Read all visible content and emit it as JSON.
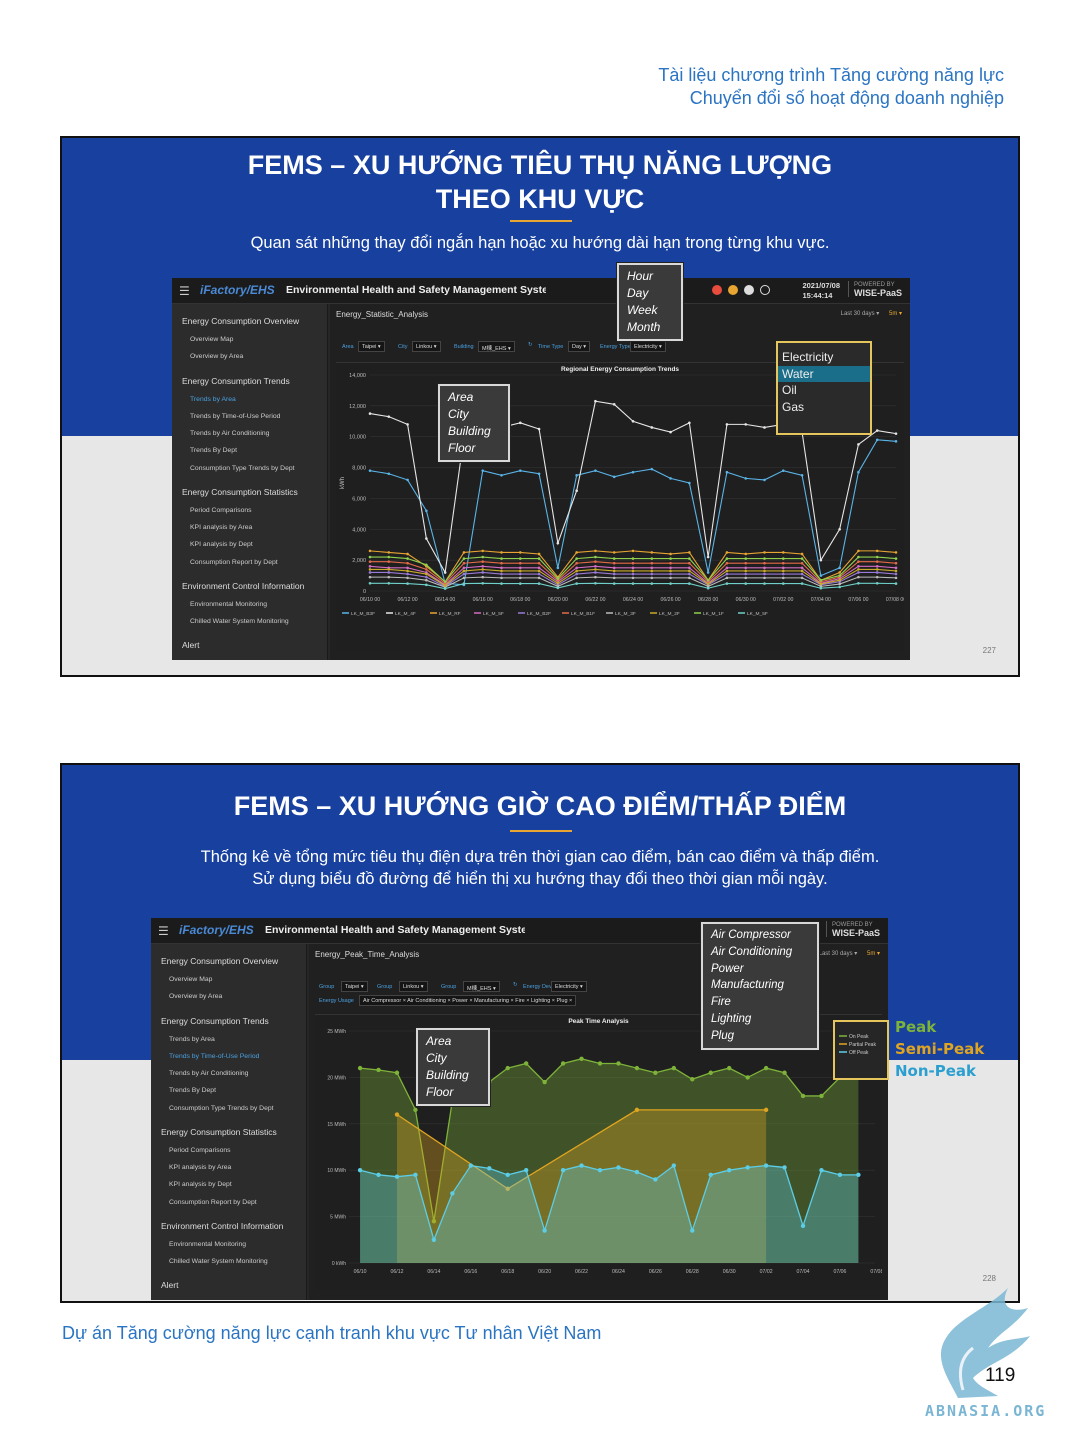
{
  "header": {
    "line1": "Tài liệu chương trình Tăng cường năng lực",
    "line2": "Chuyển đổi số hoạt động doanh nghiệp"
  },
  "slide1": {
    "title_line1": "FEMS – XU HƯỚNG TIÊU THỤ NĂNG LƯỢNG",
    "title_line2": "THEO KHU VỰC",
    "subtitle": "Quan sát những thay đổi ngắn hạn hoặc xu hướng dài hạn trong từng khu vực.",
    "page_number": "227",
    "screenshot": {
      "logo": "iFactory/EHS",
      "app_title": "Environmental Health and Safety Management System",
      "date": "2021/07/08",
      "time": "15:44:14",
      "powered_by": "POWERED BY",
      "powered_brand": "WISE-PaaS",
      "content_title": "Energy_Statistic_Analysis",
      "range_label": "Last 30 days ▾",
      "refresh": "5m ▾",
      "sidebar": [
        {
          "label": "Energy Consumption Overview",
          "type": "section"
        },
        {
          "label": "Overview Map",
          "type": "sub"
        },
        {
          "label": "Overview by Area",
          "type": "sub"
        },
        {
          "label": "Energy Consumption Trends",
          "type": "section"
        },
        {
          "label": "Trends by Area",
          "type": "sub",
          "active": true
        },
        {
          "label": "Trends by Time-of-Use Period",
          "type": "sub"
        },
        {
          "label": "Trends by Air Conditioning",
          "type": "sub"
        },
        {
          "label": "Trends By Dept",
          "type": "sub"
        },
        {
          "label": "Consumption Type Trends by Dept",
          "type": "sub"
        },
        {
          "label": "Energy Consumption Statistics",
          "type": "section"
        },
        {
          "label": "Period Comparisons",
          "type": "sub"
        },
        {
          "label": "KPI analysis by Area",
          "type": "sub"
        },
        {
          "label": "KPI analysis by Dept",
          "type": "sub"
        },
        {
          "label": "Consumption Report by Dept",
          "type": "sub"
        },
        {
          "label": "Environment Control Information",
          "type": "section"
        },
        {
          "label": "Environmental Monitoring",
          "type": "sub"
        },
        {
          "label": "Chilled Water System Monitoring",
          "type": "sub"
        },
        {
          "label": "Alert",
          "type": "section"
        }
      ],
      "filters": [
        {
          "label": "Area",
          "value": "Taipei ▾"
        },
        {
          "label": "City",
          "value": "Linkou ▾"
        },
        {
          "label": "Building",
          "value": "M棟_EHS ▾"
        },
        {
          "label": "Time Type",
          "value": "Day ▾"
        },
        {
          "label": "Energy Type",
          "value": "Electricity ▾"
        }
      ],
      "callout_time": [
        "Hour",
        "Day",
        "Week",
        "Month"
      ],
      "callout_area": [
        "Area",
        "City",
        "Building",
        "Floor"
      ],
      "energy_options": [
        "Electricity",
        "Water",
        "Oil",
        "Gas"
      ],
      "energy_selected": "Water"
    }
  },
  "slide2": {
    "title": "FEMS – XU HƯỚNG GIỜ CAO ĐIỂM/THẤP ĐIỂM",
    "subtitle_line1": "Thống kê về tổng mức tiêu thụ điện dựa trên thời gian cao điểm, bán cao điểm và thấp điểm.",
    "subtitle_line2": "Sử dụng biểu đồ đường để hiển thị xu hướng thay đổi theo thời gian mỗi ngày.",
    "page_number": "228",
    "screenshot": {
      "logo": "iFactory/EHS",
      "app_title": "Environmental Health and Safety Management System",
      "powered_by": "POWERED BY",
      "powered_brand": "WISE-PaaS",
      "content_title": "Energy_Peak_Time_Analysis",
      "range_label": "Last 30 days ▾",
      "refresh": "5m ▾",
      "sidebar": [
        {
          "label": "Energy Consumption Overview",
          "type": "section"
        },
        {
          "label": "Overview Map",
          "type": "sub"
        },
        {
          "label": "Overview by Area",
          "type": "sub"
        },
        {
          "label": "Energy Consumption Trends",
          "type": "section"
        },
        {
          "label": "Trends by Area",
          "type": "sub"
        },
        {
          "label": "Trends by Time-of-Use Period",
          "type": "sub",
          "active": true
        },
        {
          "label": "Trends by Air Conditioning",
          "type": "sub"
        },
        {
          "label": "Trends By Dept",
          "type": "sub"
        },
        {
          "label": "Consumption Type Trends by Dept",
          "type": "sub"
        },
        {
          "label": "Energy Consumption Statistics",
          "type": "section"
        },
        {
          "label": "Period Comparisons",
          "type": "sub"
        },
        {
          "label": "KPI analysis by Area",
          "type": "sub"
        },
        {
          "label": "KPI analysis by Dept",
          "type": "sub"
        },
        {
          "label": "Consumption Report by Dept",
          "type": "sub"
        },
        {
          "label": "Environment Control Information",
          "type": "section"
        },
        {
          "label": "Environmental Monitoring",
          "type": "sub"
        },
        {
          "label": "Chilled Water System Monitoring",
          "type": "sub"
        },
        {
          "label": "Alert",
          "type": "section"
        }
      ],
      "filters": [
        {
          "label": "Group",
          "value": "Taipei ▾"
        },
        {
          "label": "Group",
          "value": "Linkou ▾"
        },
        {
          "label": "Group",
          "value": "M棟_EHS ▾"
        },
        {
          "label": "Energy Device",
          "value": "Electricity ▾"
        }
      ],
      "usage_label": "Energy Usage",
      "usage_tags": "Air Compressor × Air Conditioning × Power × Manufacturing × Fire × Lighting × Plug ×",
      "callout_device": [
        "Air Compressor",
        "Air Conditioning",
        "Power",
        "Manufacturing",
        "Fire",
        "Lighting",
        "Plug"
      ],
      "callout_area": [
        "Area",
        "City",
        "Building",
        "Floor"
      ]
    },
    "legend_ext": [
      {
        "label": "Peak",
        "color": "#7eb33a"
      },
      {
        "label": "Semi-Peak",
        "color": "#e0a520"
      },
      {
        "label": "Non-Peak",
        "color": "#2b9fd0"
      }
    ]
  },
  "chart_data": [
    {
      "type": "line",
      "title": "Regional Energy Consumption Trends",
      "ylabel": "kWh",
      "ylim": [
        0,
        14000
      ],
      "yticks": [
        "0",
        "2,000",
        "4,000",
        "6,000",
        "8,000",
        "10,000",
        "12,000",
        "14,000"
      ],
      "x": [
        "06/10 00",
        "06/11",
        "06/12 00",
        "06/13",
        "06/14 00",
        "06/15",
        "06/16 00",
        "06/17",
        "06/18 00",
        "06/19",
        "06/20 00",
        "06/21",
        "06/22 00",
        "06/23",
        "06/24 00",
        "06/25",
        "06/26 00",
        "06/27",
        "06/28 00",
        "06/29",
        "06/30 00",
        "07/01",
        "07/02 00",
        "07/03",
        "07/04 00",
        "07/05",
        "07/06 00",
        "07/07",
        "07/08 00"
      ],
      "xticks": [
        "06/10 00",
        "06/12 00",
        "06/14 00",
        "06/16 00",
        "06/18 00",
        "06/20 00",
        "06/22 00",
        "06/24 00",
        "06/26 00",
        "06/28 00",
        "06/30 00",
        "07/02 00",
        "07/04 00",
        "07/06 00",
        "07/08 00"
      ],
      "series": [
        {
          "name": "LK_M_B3F",
          "color": "#5ab4e8",
          "values": [
            7800,
            7600,
            7200,
            5200,
            500,
            400,
            7800,
            7500,
            7800,
            7600,
            1500,
            7500,
            7800,
            7400,
            7700,
            7900,
            7300,
            7000,
            1200,
            7700,
            7300,
            7200,
            7800,
            7500,
            1000,
            1500,
            7700,
            9800,
            9700
          ]
        },
        {
          "name": "LK_M_4F",
          "color": "#e6e6e6",
          "values": [
            11500,
            11300,
            10800,
            3400,
            1200,
            10000,
            10800,
            10600,
            10900,
            10500,
            3100,
            6500,
            12300,
            12100,
            11000,
            10600,
            10300,
            10900,
            2200,
            10800,
            10800,
            10600,
            10800,
            10300,
            2000,
            4000,
            9500,
            10400,
            10200
          ]
        },
        {
          "name": "LK_M_RF",
          "color": "#e8a531",
          "values": [
            2600,
            2500,
            2400,
            1600,
            600,
            2500,
            2600,
            2500,
            2500,
            2400,
            900,
            2500,
            2600,
            2500,
            2600,
            2500,
            2400,
            2500,
            700,
            2500,
            2400,
            2500,
            2500,
            2400,
            700,
            1200,
            2600,
            2600,
            2500
          ]
        },
        {
          "name": "LK_M_5F",
          "color": "#d46cc2",
          "values": [
            1600,
            1500,
            1500,
            1200,
            400,
            1500,
            1600,
            1500,
            1500,
            1500,
            600,
            1500,
            1600,
            1500,
            1500,
            1500,
            1500,
            1500,
            500,
            1500,
            1500,
            1500,
            1500,
            1500,
            500,
            800,
            1600,
            1600,
            1500
          ]
        },
        {
          "name": "LK_M_B2F",
          "color": "#9a7ad8",
          "values": [
            1200,
            1200,
            1100,
            900,
            300,
            1100,
            1200,
            1100,
            1100,
            1100,
            400,
            1100,
            1200,
            1100,
            1100,
            1100,
            1100,
            1100,
            400,
            1100,
            1100,
            1100,
            1100,
            1100,
            400,
            600,
            1200,
            1200,
            1100
          ]
        },
        {
          "name": "LK_M_B1F",
          "color": "#e56a4a",
          "values": [
            1900,
            1900,
            1800,
            1400,
            500,
            1800,
            1900,
            1800,
            1800,
            1800,
            700,
            1800,
            1900,
            1800,
            1800,
            1800,
            1800,
            1800,
            600,
            1800,
            1800,
            1800,
            1800,
            1800,
            600,
            900,
            1900,
            1900,
            1800
          ]
        },
        {
          "name": "LK_M_3F",
          "color": "#bbbbbb",
          "values": [
            900,
            900,
            850,
            700,
            250,
            850,
            900,
            850,
            850,
            850,
            300,
            850,
            900,
            850,
            850,
            850,
            850,
            850,
            300,
            850,
            850,
            850,
            850,
            850,
            300,
            450,
            900,
            900,
            850
          ]
        },
        {
          "name": "LK_M_2F",
          "color": "#c9a92a",
          "values": [
            1400,
            1400,
            1300,
            1100,
            350,
            1300,
            1400,
            1300,
            1300,
            1300,
            500,
            1300,
            1400,
            1300,
            1300,
            1300,
            1300,
            1300,
            450,
            1300,
            1300,
            1300,
            1300,
            1300,
            450,
            700,
            1400,
            1400,
            1300
          ]
        },
        {
          "name": "LK_M_1F",
          "color": "#8fd14f",
          "values": [
            2200,
            2200,
            2100,
            1700,
            600,
            2100,
            2200,
            2100,
            2100,
            2100,
            800,
            2100,
            2200,
            2100,
            2100,
            2100,
            2100,
            2100,
            700,
            2100,
            2100,
            2100,
            2100,
            2100,
            700,
            1000,
            2200,
            2200,
            2100
          ]
        },
        {
          "name": "LK_M_5F",
          "color": "#6ed0c8",
          "values": [
            500,
            500,
            480,
            400,
            150,
            480,
            500,
            480,
            480,
            480,
            200,
            480,
            500,
            480,
            480,
            480,
            480,
            480,
            180,
            480,
            480,
            480,
            480,
            480,
            180,
            260,
            500,
            500,
            480
          ]
        }
      ]
    },
    {
      "type": "area",
      "title": "Peak Time Analysis",
      "ylim": [
        0,
        25
      ],
      "yticks": [
        "0 kWh",
        "5 MWh",
        "10 MWh",
        "15 MWh",
        "20 MWh",
        "25 MWh"
      ],
      "x": [
        "06/10",
        "06/11",
        "06/12",
        "06/13",
        "06/14",
        "06/15",
        "06/16",
        "06/17",
        "06/18",
        "06/19",
        "06/20",
        "06/21",
        "06/22",
        "06/23",
        "06/24",
        "06/25",
        "06/26",
        "06/27",
        "06/28",
        "06/29",
        "06/30",
        "07/01",
        "07/02",
        "07/03",
        "07/04",
        "07/05",
        "07/06",
        "07/07"
      ],
      "xticks": [
        "06/10",
        "06/12",
        "06/14",
        "06/16",
        "06/18",
        "06/20",
        "06/22",
        "06/24",
        "06/26",
        "06/28",
        "06/30",
        "07/02",
        "07/04",
        "07/06",
        "07/08"
      ],
      "series": [
        {
          "name": "On Peak",
          "color": "#7eb33a",
          "values": [
            21,
            20.8,
            20.5,
            16.5,
            4.5,
            17.5,
            20.5,
            19.5,
            21,
            21.5,
            19.5,
            21.5,
            22,
            21.5,
            21.5,
            21,
            20.5,
            21,
            19.8,
            20.5,
            21,
            20,
            21,
            20.5,
            18,
            18,
            20,
            21
          ]
        },
        {
          "name": "Partial Peak",
          "color": "#e0a520",
          "values": [
            null,
            null,
            16,
            null,
            null,
            null,
            null,
            null,
            8,
            null,
            null,
            null,
            null,
            null,
            null,
            16.5,
            null,
            null,
            null,
            null,
            null,
            null,
            16.5,
            null,
            null,
            null,
            null,
            null
          ]
        },
        {
          "name": "Off Peak",
          "color": "#5ccde6",
          "values": [
            10,
            9.5,
            9.3,
            9.5,
            2.5,
            7.5,
            10.5,
            10.2,
            9.5,
            10,
            3.5,
            10,
            10.5,
            10,
            10.3,
            9.8,
            9,
            10.5,
            3.5,
            9.5,
            10,
            10.3,
            10.5,
            10.3,
            4,
            10,
            9.5,
            9.5
          ]
        }
      ]
    }
  ],
  "footer": {
    "project": "Dự án Tăng cường năng lực cạnh tranh khu vực Tư nhân Việt Nam",
    "page": "119",
    "brand": "ABNASIA.ORG"
  }
}
